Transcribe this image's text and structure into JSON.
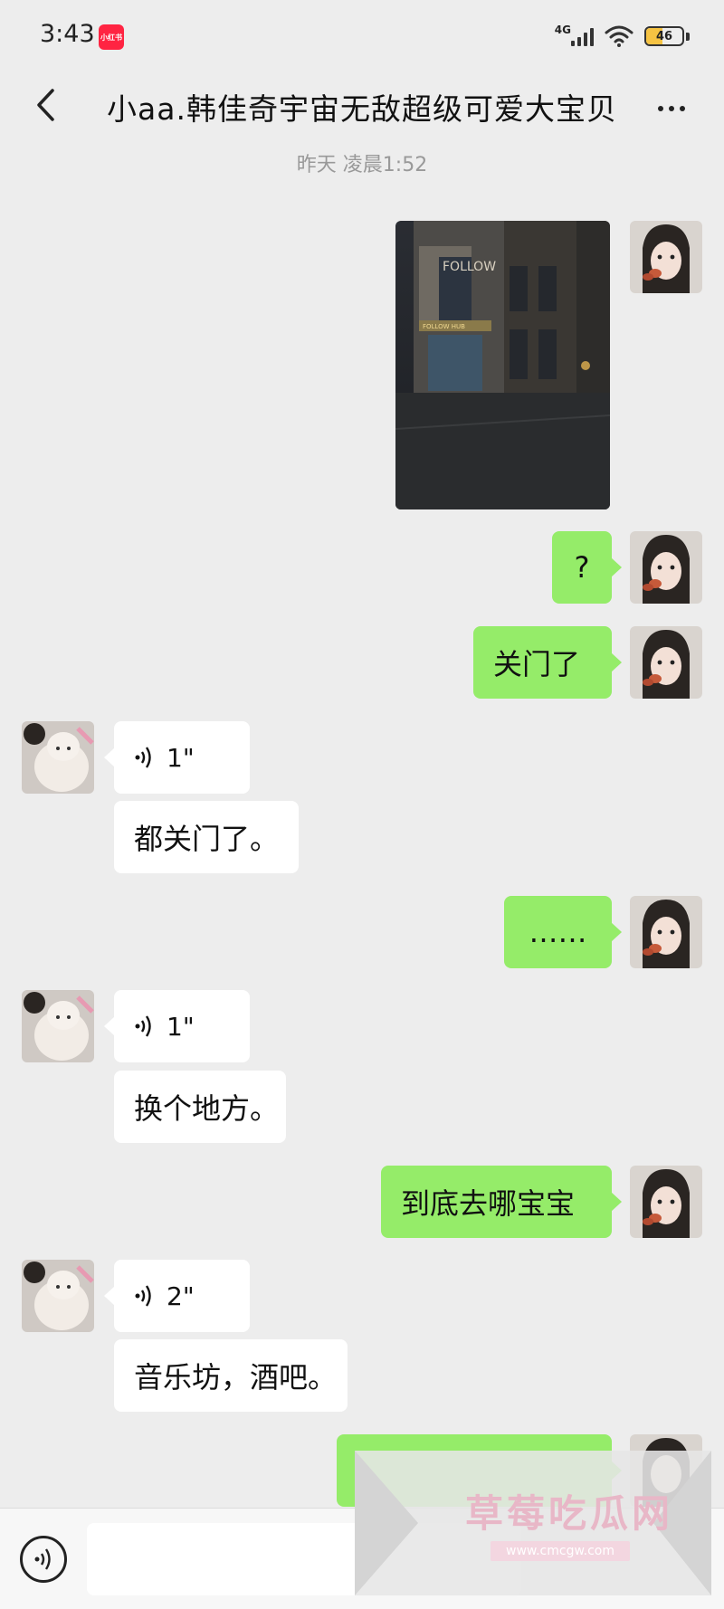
{
  "status_bar": {
    "time": "3:43",
    "app_badge": "小红书",
    "network": "4G",
    "battery": "46"
  },
  "header": {
    "title": "小aa.韩佳奇宇宙无敌超级可爱大宝贝"
  },
  "timestamp": "昨天 凌晨1:52",
  "messages": [
    {
      "sender": "me",
      "type": "image"
    },
    {
      "sender": "me",
      "type": "text",
      "text": "?"
    },
    {
      "sender": "me",
      "type": "text",
      "text": "关门了"
    },
    {
      "sender": "them",
      "type": "voice",
      "duration": "1\""
    },
    {
      "sender": "them",
      "type": "text",
      "text": "都关门了。"
    },
    {
      "sender": "me",
      "type": "text",
      "text": "……"
    },
    {
      "sender": "them",
      "type": "voice",
      "duration": "1\""
    },
    {
      "sender": "them",
      "type": "text",
      "text": "换个地方。"
    },
    {
      "sender": "me",
      "type": "text",
      "text": "到底去哪宝宝"
    },
    {
      "sender": "them",
      "type": "voice",
      "duration": "2\""
    },
    {
      "sender": "them",
      "type": "text",
      "text": "音乐坊，酒吧。"
    },
    {
      "sender": "me",
      "type": "text",
      "text": ""
    }
  ],
  "photo": {
    "sign_text": "FOLLOW",
    "shop_text": "FOLLOW HUB"
  },
  "watermark": {
    "text": "草莓吃瓜网",
    "url": "www.cmcgw.com"
  },
  "colors": {
    "background": "#ededed",
    "my_bubble": "#95ec69",
    "their_bubble": "#ffffff"
  }
}
